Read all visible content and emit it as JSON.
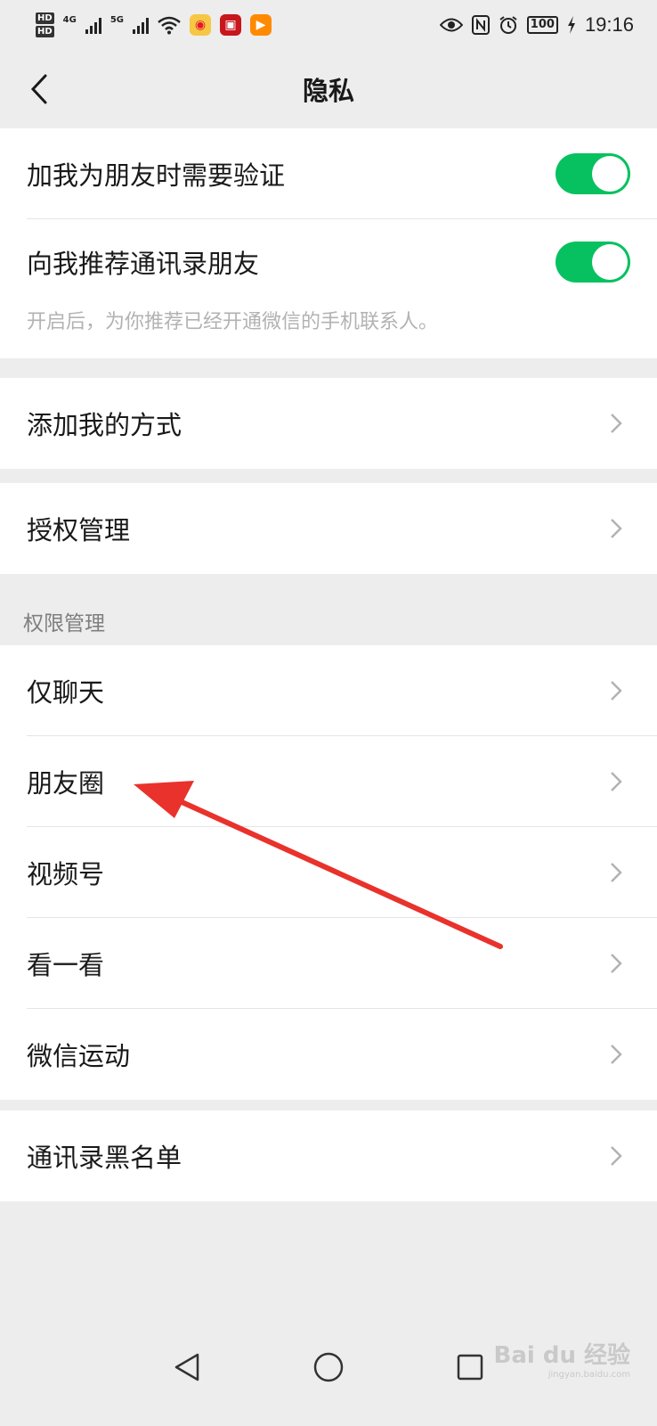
{
  "status_bar": {
    "hd1": "HD",
    "hd2": "HD",
    "net1": "4G",
    "net2": "5G",
    "battery": "100",
    "time": "19:16"
  },
  "nav": {
    "title": "隐私"
  },
  "group1": {
    "item1": "加我为朋友时需要验证",
    "item2": "向我推荐通讯录朋友",
    "hint": "开启后，为你推荐已经开通微信的手机联系人。"
  },
  "group2": {
    "item1": "添加我的方式"
  },
  "group3": {
    "item1": "授权管理"
  },
  "permissions": {
    "header": "权限管理",
    "items": [
      "仅聊天",
      "朋友圈",
      "视频号",
      "看一看",
      "微信运动"
    ]
  },
  "group5": {
    "item1": "通讯录黑名单"
  },
  "watermark": {
    "brand": "Bai du 经验",
    "url": "jingyan.baidu.com"
  },
  "colors": {
    "accent": "#07c160",
    "annotation": "#e8322b"
  }
}
